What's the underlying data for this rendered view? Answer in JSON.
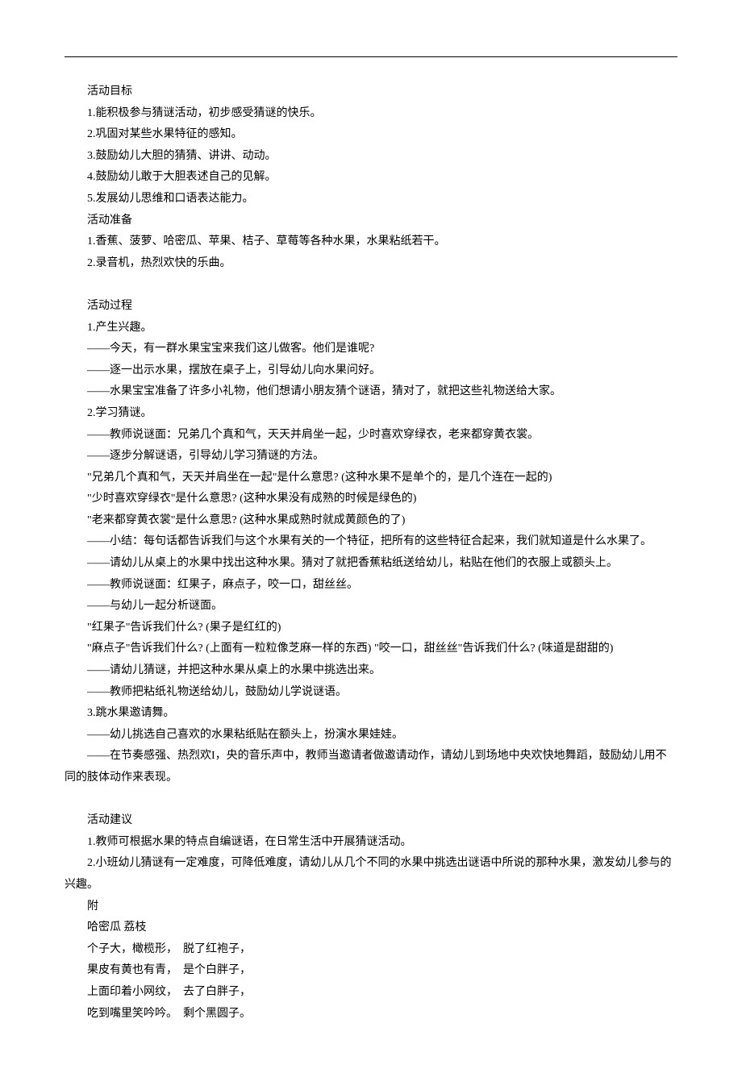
{
  "sections": [
    {
      "lines": [
        "活动目标",
        "1.能积极参与猜谜活动，初步感受猜谜的快乐。",
        "2.巩固对某些水果特征的感知。",
        "3.鼓励幼儿大胆的猜猜、讲讲、动动。",
        "4.鼓励幼儿敢于大胆表述自己的见解。",
        "5.发展幼儿思维和口语表达能力。",
        "活动准备",
        "1.香蕉、菠萝、哈密瓜、苹果、桔子、草莓等各种水果，水果粘纸若干。",
        "2.录音机，热烈欢快的乐曲。"
      ]
    },
    {
      "lines": [
        "活动过程",
        "1.产生兴趣。",
        "——今天，有一群水果宝宝来我们这儿做客。他们是谁呢?",
        "——逐一出示水果，摆放在桌子上，引导幼儿向水果问好。",
        "——水果宝宝准备了许多小礼物，他们想请小朋友猜个谜语，猜对了，就把这些礼物送给大家。",
        "2.学习猜谜。",
        "——教师说谜面：兄弟几个真和气，天天并肩坐一起，少时喜欢穿绿衣，老来都穿黄衣裳。",
        "——逐步分解谜语，引导幼儿学习猜谜的方法。",
        "\"兄弟几个真和气，天天并肩坐在一起\"是什么意思? (这种水果不是单个的，是几个连在一起的)",
        "\"少时喜欢穿绿衣\"是什么意思? (这种水果没有成熟的时候是绿色的)",
        "\"老来都穿黄衣裳\"是什么意思? (这种水果成熟时就成黄颜色的了)",
        "——小结：每句话都告诉我们与这个水果有关的一个特征，把所有的这些特征合起来，我们就知道是什么水果了。",
        "——请幼儿从桌上的水果中找出这种水果。猜对了就把香蕉粘纸送给幼儿，粘贴在他们的衣服上或额头上。",
        "——教师说谜面：红果子，麻点子，咬一口，甜丝丝。",
        "——与幼儿一起分析谜面。",
        "\"红果子\"告诉我们什么? (果子是红红的)",
        "\"麻点子\"告诉我们什么? (上面有一粒粒像芝麻一样的东西) \"咬一口，甜丝丝\"告诉我们什么? (味道是甜甜的)",
        "——请幼儿猜谜，并把这种水果从桌上的水果中挑选出来。",
        "——教师把粘纸礼物送给幼儿，鼓励幼儿学说谜语。",
        "3.跳水果邀请舞。",
        "——幼儿挑选自己喜欢的水果粘纸贴在额头上，扮演水果娃娃。",
        "——在节奏感强、热烈欢I，央的音乐声中，教师当邀请者做邀请动作，请幼儿到场地中央欢快地舞蹈，鼓励幼儿用不同的肢体动作来表现。"
      ]
    },
    {
      "lines": [
        "活动建议",
        "1.教师可根据水果的特点自编谜语，在日常生活中开展猜谜活动。",
        "2.小班幼儿猜谜有一定难度，可降低难度，请幼儿从几个不同的水果中挑选出谜语中所说的那种水果，激发幼儿参与的兴趣。",
        "附",
        "哈密瓜 荔枝",
        "个子大，橄榄形，　脱了红袍子，",
        "果皮有黄也有青，　是个白胖子，",
        "上面印着小网纹，　去了白胖子，",
        "吃到嘴里笑吟吟。　剩个黑圆子。"
      ]
    }
  ]
}
